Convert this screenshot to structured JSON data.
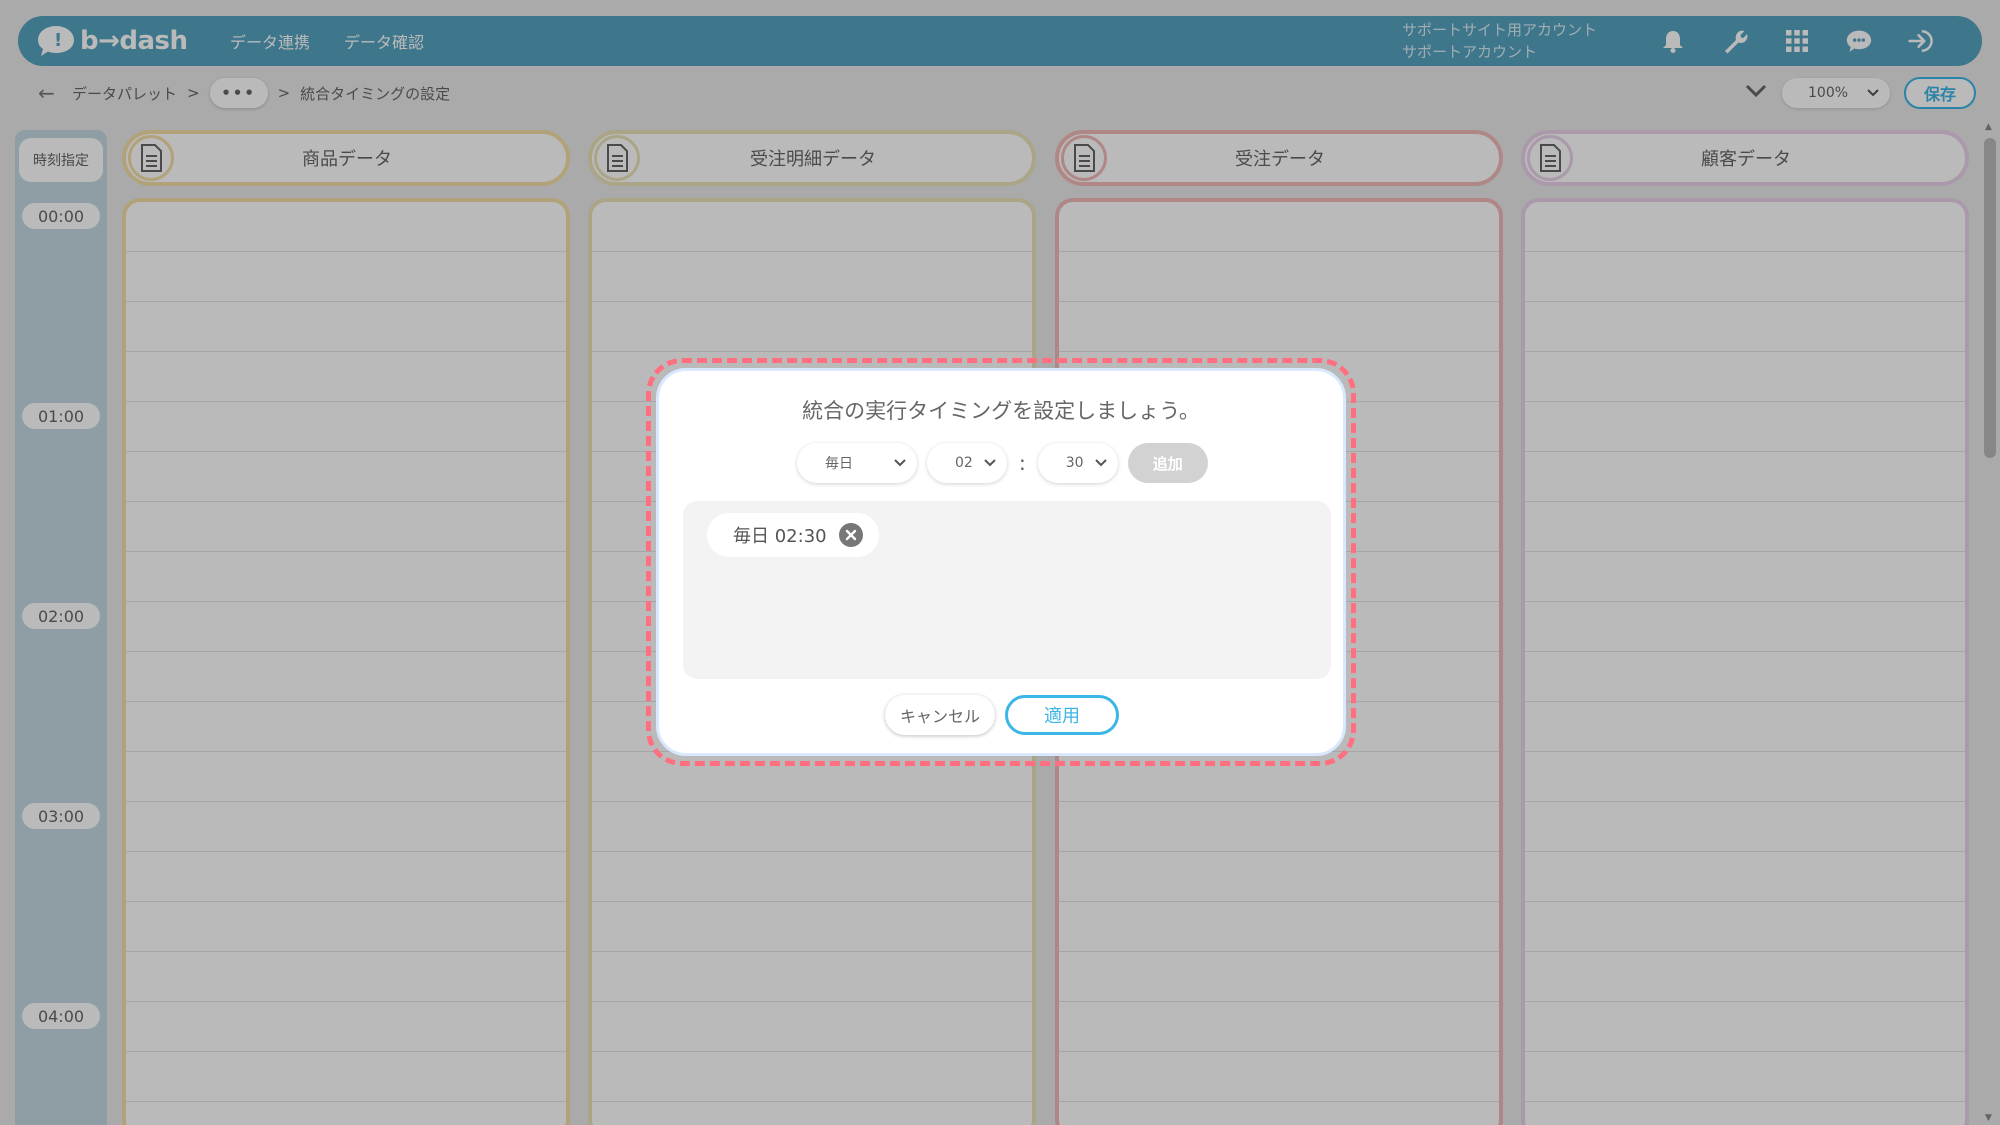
{
  "header": {
    "logo_text": "b→dash",
    "nav": [
      "データ連携",
      "データ確認"
    ],
    "account_line1": "サポートサイト用アカウント",
    "account_line2": "サポートアカウント",
    "icons": [
      "bell-icon",
      "wrench-icon",
      "grid-icon",
      "chat-icon",
      "logout-icon"
    ],
    "accent_color": "#56a3c0"
  },
  "breadcrumb": {
    "back_glyph": "←",
    "root": "データパレット",
    "sep": ">",
    "more": "•••",
    "current": "統合タイミングの設定"
  },
  "toolbar": {
    "zoom": "100%",
    "save_label": "保存"
  },
  "timeline": {
    "header": "時刻指定",
    "times": [
      "00:00",
      "01:00",
      "02:00",
      "03:00",
      "04:00"
    ]
  },
  "columns": [
    {
      "title": "商品データ",
      "color": "#f3dfa6"
    },
    {
      "title": "受注明細データ",
      "color": "#e9e2b8"
    },
    {
      "title": "受注データ",
      "color": "#f2b9b9"
    },
    {
      "title": "顧客データ",
      "color": "#e9d2ea"
    }
  ],
  "modal": {
    "title": "統合の実行タイミングを設定しましょう。",
    "frequency": "毎日",
    "hour": "02",
    "colon": ":",
    "minute": "30",
    "add_label": "追加",
    "chips": [
      {
        "label": "毎日 02:30"
      }
    ],
    "cancel_label": "キャンセル",
    "apply_label": "適用",
    "highlight_color": "#ff6f7f"
  }
}
